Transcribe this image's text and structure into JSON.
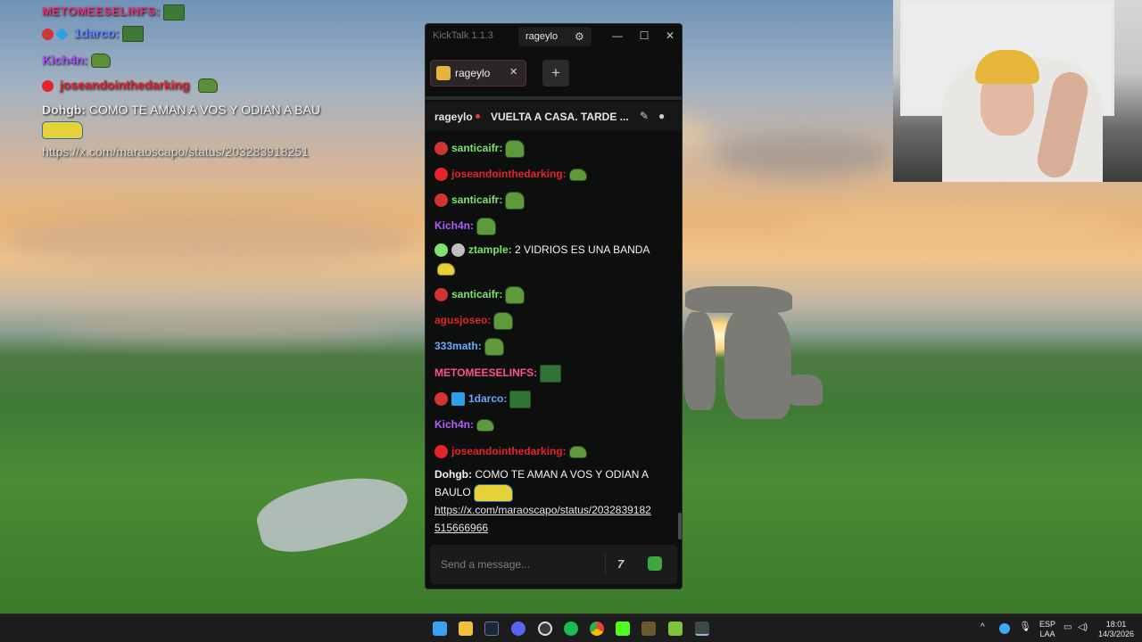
{
  "overlay": {
    "lines": [
      {
        "user": "METOMEESELINFS:",
        "color": "#e7337a",
        "text": ""
      },
      {
        "user": "1darco:",
        "color": "#5b8cff",
        "text": ""
      },
      {
        "user": "Kich4n:",
        "color": "#a855f7",
        "text": ""
      },
      {
        "user": "joseandointhedarking",
        "color": "#e3242b",
        "text": ""
      },
      {
        "user": "Dohgb:",
        "color": "#e8e8e8",
        "text": "COMO TE AMAN A VOS Y ODIAN A BAU"
      },
      {
        "user": "",
        "color": "#e8e8e8",
        "text": "https://x.com/maraoscapo/status/203283918251"
      }
    ]
  },
  "app": {
    "title": "KickTalk 1.1.3",
    "user": "rageylo",
    "window_buttons": [
      "—",
      "☐",
      "✕"
    ],
    "tab": {
      "label": "rageylo",
      "close": "✕"
    },
    "add_tab": "+",
    "channel": "rageylo",
    "stream_title": "VUELTA A CASA. TARDE ...",
    "input_placeholder": "Send a message...",
    "seven_tv_label": "7",
    "messages": [
      {
        "user": "santicaifr:",
        "color": "#7ee26e",
        "text": "",
        "badge": "#d23434"
      },
      {
        "user": "joseandointhedarking:",
        "color": "#e3242b",
        "text": "",
        "badge": "#e3242b"
      },
      {
        "user": "santicaifr:",
        "color": "#7ee26e",
        "text": "",
        "badge": "#d23434"
      },
      {
        "user": "Kich4n:",
        "color": "#b35cff",
        "text": "",
        "badge": ""
      },
      {
        "user": "ztample:",
        "color": "#7ee26e",
        "text": "2 VIDRIOS ES UNA BANDA",
        "badge": "#bfbfbf"
      },
      {
        "user": "santicaifr:",
        "color": "#7ee26e",
        "text": "",
        "badge": "#d23434"
      },
      {
        "user": "agusjoseo:",
        "color": "#e3242b",
        "text": "",
        "badge": ""
      },
      {
        "user": "333math:",
        "color": "#6aa8ff",
        "text": "",
        "badge": ""
      },
      {
        "user": "METOMEESELINFS:",
        "color": "#ff4f8a",
        "text": "",
        "badge": ""
      },
      {
        "user": "1darco:",
        "color": "#6aa8ff",
        "text": "",
        "badge": "#d23434"
      },
      {
        "user": "Kich4n:",
        "color": "#b35cff",
        "text": "",
        "badge": ""
      },
      {
        "user": "joseandointhedarking:",
        "color": "#e3242b",
        "text": "",
        "badge": "#e3242b"
      },
      {
        "user": "Dohgb:",
        "color": "#f2f2f2",
        "text": "COMO TE AMAN A VOS Y ODIAN A",
        "badge": ""
      }
    ],
    "last_text_line2": "BAULO",
    "link_line1": "https://x.com/maraoscapo/status/2032839182",
    "link_line2": "515666966"
  },
  "taskbar": {
    "lang_top": "ESP",
    "lang_bottom": "LAA",
    "time": "18:01",
    "date": "14/3/2026",
    "icons": [
      "start-icon",
      "file-explorer-icon",
      "steam-icon",
      "discord-icon",
      "obs-icon",
      "spotify-icon",
      "chrome-icon",
      "kick-icon",
      "minecraft-icon",
      "cube-icon",
      "kicktalk-icon"
    ]
  }
}
